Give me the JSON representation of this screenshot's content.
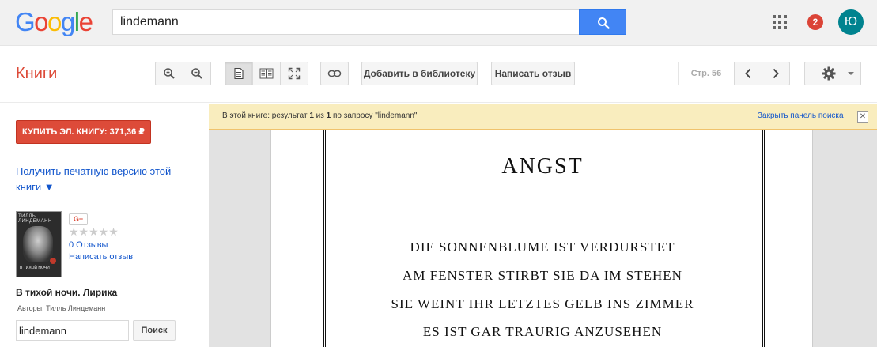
{
  "header": {
    "logo_letters": [
      {
        "char": "G",
        "color": "#4285f4"
      },
      {
        "char": "o",
        "color": "#ea4335"
      },
      {
        "char": "o",
        "color": "#fbbc05"
      },
      {
        "char": "g",
        "color": "#4285f4"
      },
      {
        "char": "l",
        "color": "#34a853"
      },
      {
        "char": "e",
        "color": "#ea4335"
      }
    ],
    "search_value": "lindemann",
    "notification_count": "2",
    "avatar_initial": "Ю"
  },
  "toolbar": {
    "section_title": "Книги",
    "add_to_library_label": "Добавить в библиотеку",
    "write_review_label": "Написать отзыв",
    "page_label": "Стр. 56"
  },
  "sidebar": {
    "buy_button_label": "КУПИТЬ ЭЛ. КНИГУ: 371,36 ₽",
    "print_version_link": "Получить печатную версию этой книги ▼",
    "cover": {
      "title_text": "ТИЛЛЬ ЛИНДЕМАНН",
      "subtitle_text": "В ТИХОЙ НОЧИ"
    },
    "gplus_label": "G+",
    "stars": "★★★★★",
    "reviews_link": "0 Отзывы",
    "write_review_link": "Написать отзыв",
    "book_title": "В тихой ночи. Лирика",
    "authors": "Авторы: Тилль Линдеманн",
    "search_value": "lindemann",
    "search_button_label": "Поиск"
  },
  "viewer": {
    "notice": {
      "prefix": "В этой книге: результат ",
      "current": "1",
      "middle": " из ",
      "total": "1",
      "suffix": " по запросу \"lindemann\"",
      "close_link": "Закрыть панель поиска",
      "close_x": "✕"
    },
    "page": {
      "heading": "ANGST",
      "lines": [
        "DIE SONNENBLUME IST VERDURSTET",
        "AM FENSTER STIRBT SIE DA IM STEHEN",
        "SIE WEINT IHR LETZTES GELB INS ZIMMER",
        "ES IST GAR TRAURIG ANZUSEHEN"
      ]
    }
  }
}
